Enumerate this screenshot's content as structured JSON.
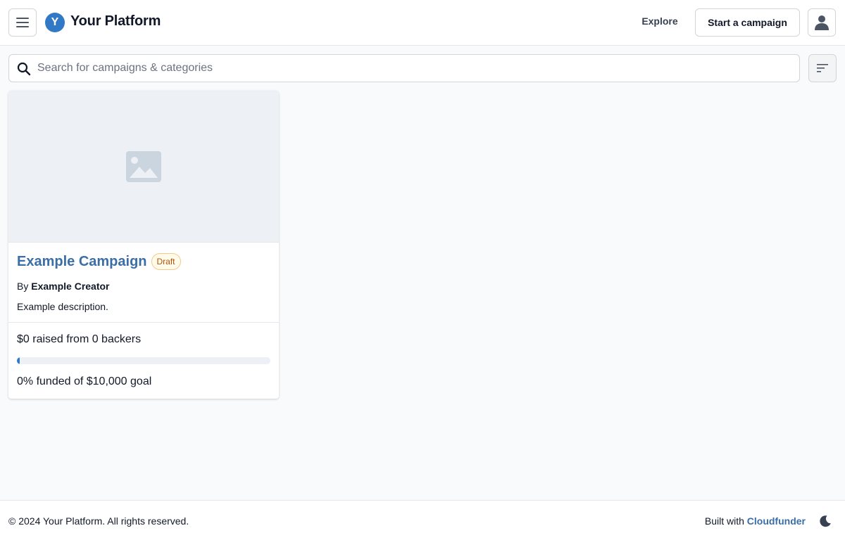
{
  "header": {
    "menu_icon": "hamburger-menu-icon",
    "logo_letter": "Y",
    "brand": "Your Platform",
    "explore_label": "Explore",
    "start_campaign_label": "Start a campaign",
    "user_icon": "user-icon"
  },
  "search": {
    "placeholder": "Search for campaigns & categories",
    "value": "",
    "search_icon": "search-icon",
    "filter_icon": "sort-filter-icon"
  },
  "campaigns": [
    {
      "image_icon": "image-placeholder-icon",
      "title": "Example Campaign",
      "badge": "Draft",
      "by_prefix": "By",
      "creator": "Example Creator",
      "description": "Example description.",
      "raised_text": "$0 raised from 0 backers",
      "progress_percent": 0,
      "funded_text": "0% funded of $10,000 goal"
    }
  ],
  "footer": {
    "copyright": "© 2024 Your Platform. All rights reserved.",
    "built_prefix": "Built with",
    "built_link": "Cloudfunder",
    "theme_icon": "moon-icon"
  },
  "colors": {
    "accent": "#3178c6",
    "link": "#3a6ea5",
    "badge_text": "#b45309",
    "badge_border": "#f6c88a",
    "background": "#f8fafc"
  }
}
